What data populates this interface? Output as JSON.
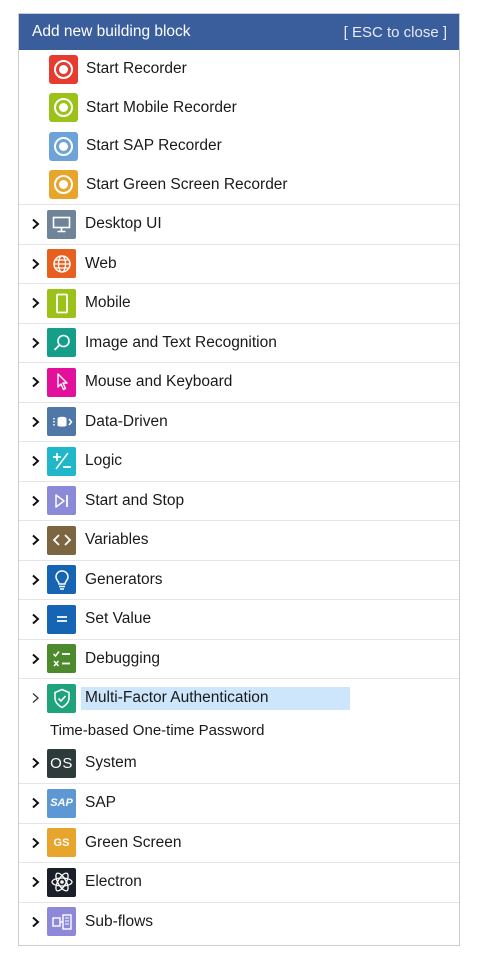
{
  "header": {
    "title": "Add new building block",
    "close_hint": "[ ESC to close ]"
  },
  "recorders": [
    {
      "label": "Start Recorder",
      "icon": "record-icon",
      "color": "#e63b2e"
    },
    {
      "label": "Start Mobile Recorder",
      "icon": "record-icon",
      "color": "#9cc21a"
    },
    {
      "label": "Start SAP Recorder",
      "icon": "record-icon",
      "color": "#6da3d8"
    },
    {
      "label": "Start Green Screen Recorder",
      "icon": "record-icon",
      "color": "#e8a52b"
    }
  ],
  "categories": [
    {
      "label": "Desktop UI",
      "icon": "monitor-icon",
      "color": "#6f8399"
    },
    {
      "label": "Web",
      "icon": "globe-icon",
      "color": "#e8601f"
    },
    {
      "label": "Mobile",
      "icon": "smartphone-icon",
      "color": "#9cc21a"
    },
    {
      "label": "Image and Text Recognition",
      "icon": "magnifier-icon",
      "color": "#159e8a"
    },
    {
      "label": "Mouse and Keyboard",
      "icon": "cursor-icon",
      "color": "#e2109b"
    },
    {
      "label": "Data-Driven",
      "icon": "database-icon",
      "color": "#4f78a8"
    },
    {
      "label": "Logic",
      "icon": "plus-minus-icon",
      "color": "#1fb7c9"
    },
    {
      "label": "Start and Stop",
      "icon": "play-stop-icon",
      "color": "#8a8ad8"
    },
    {
      "label": "Variables",
      "icon": "code-brackets-icon",
      "color": "#7c6541"
    },
    {
      "label": "Generators",
      "icon": "lightbulb-icon",
      "color": "#1565b4"
    },
    {
      "label": "Set Value",
      "icon": "equals-icon",
      "color": "#1565b4"
    },
    {
      "label": "Debugging",
      "icon": "checklist-icon",
      "color": "#4d8a2d"
    }
  ],
  "selected": {
    "label": "Multi-Factor Authentication",
    "icon": "shield-check-icon",
    "color": "#1ea37c",
    "sub_item": "Time-based One-time Password"
  },
  "categories_after": [
    {
      "label": "System",
      "icon": "os-icon",
      "badge": "OS",
      "color": "#2d3b3b"
    },
    {
      "label": "SAP",
      "icon": "sap-icon",
      "badge": "SAP",
      "color": "#5d97d4"
    },
    {
      "label": "Green Screen",
      "icon": "gs-icon",
      "badge": "GS",
      "color": "#e8a52b"
    },
    {
      "label": "Electron",
      "icon": "electron-icon",
      "color": "#1b1f2a"
    },
    {
      "label": "Sub-flows",
      "icon": "subflow-icon",
      "color": "#8e88d8"
    }
  ]
}
